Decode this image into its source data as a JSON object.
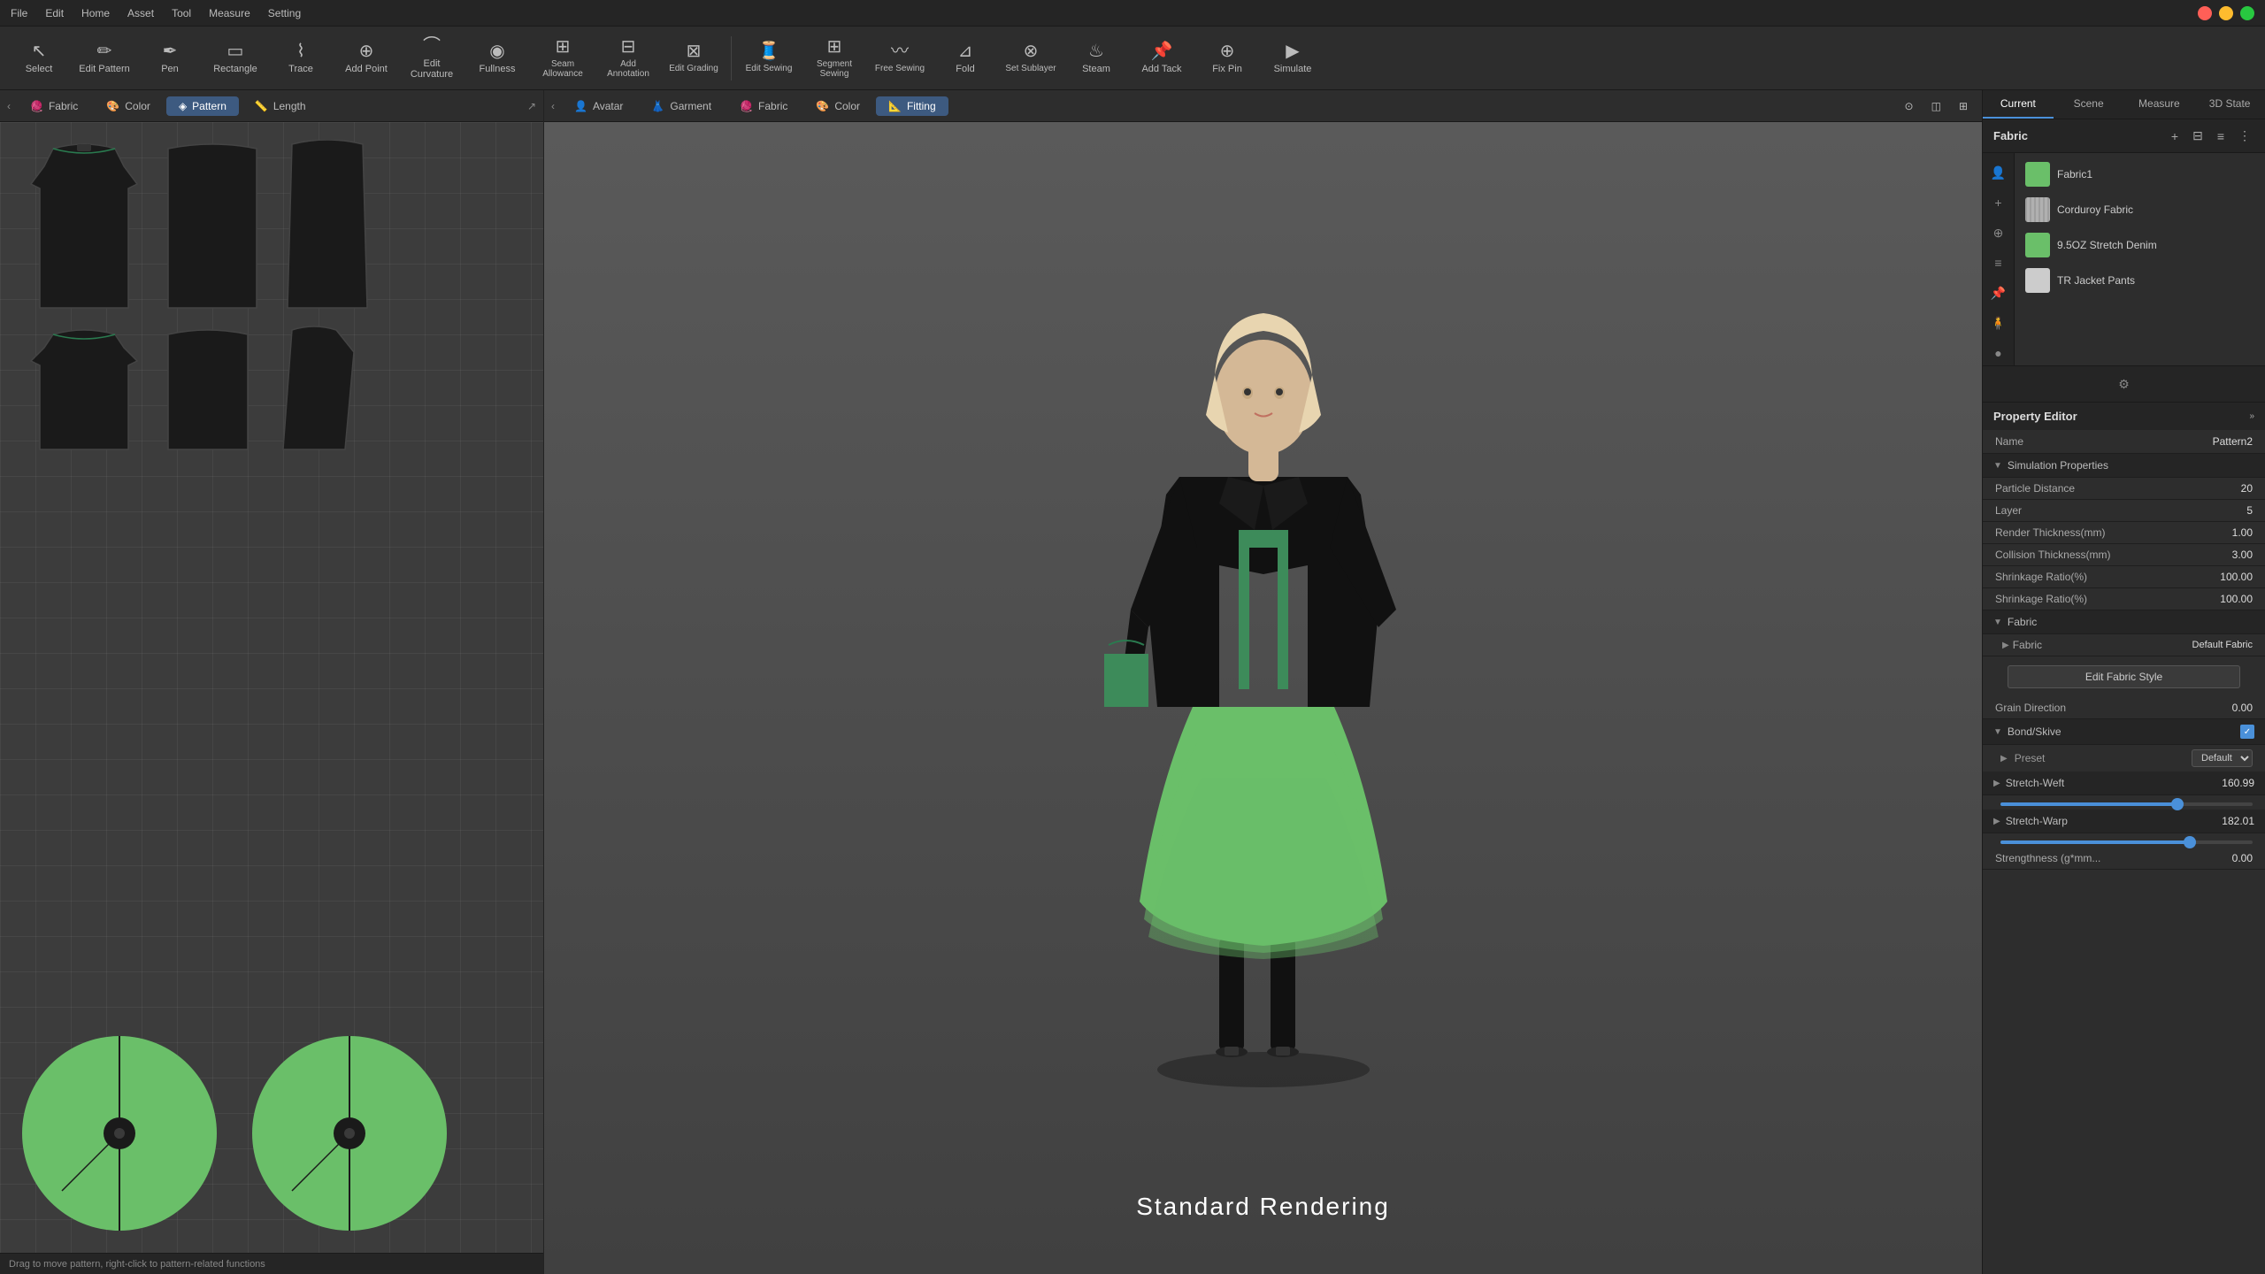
{
  "menubar": {
    "items": [
      "File",
      "Edit",
      "Home",
      "Asset",
      "Tool",
      "Measure",
      "Setting"
    ]
  },
  "toolbar": {
    "tools": [
      {
        "id": "select",
        "label": "Select",
        "icon": "↖",
        "active": false
      },
      {
        "id": "edit-pattern",
        "label": "Edit Pattern",
        "icon": "✏",
        "active": false
      },
      {
        "id": "pen",
        "label": "Pen",
        "icon": "✒",
        "active": false
      },
      {
        "id": "rectangle",
        "label": "Rectangle",
        "icon": "▭",
        "active": false
      },
      {
        "id": "trace",
        "label": "Trace",
        "icon": "⌇",
        "active": false
      },
      {
        "id": "add-point",
        "label": "Add Point",
        "icon": "⊕",
        "active": false
      },
      {
        "id": "edit-curvature",
        "label": "Edit Curvature",
        "icon": "⌒",
        "active": false
      },
      {
        "id": "fullness",
        "label": "Fullness",
        "icon": "◉",
        "active": false
      },
      {
        "id": "seam-allowance",
        "label": "Seam Allowance",
        "icon": "⊞",
        "active": false
      },
      {
        "id": "add-annotation",
        "label": "Add Annotation",
        "icon": "⊟",
        "active": false
      },
      {
        "id": "edit-grading",
        "label": "Edit Grading",
        "icon": "⊠",
        "active": false
      },
      {
        "id": "sep1",
        "sep": true
      },
      {
        "id": "edit-sewing",
        "label": "Edit Sewing",
        "icon": "🧵",
        "active": false
      },
      {
        "id": "segment-sewing",
        "label": "Segment Sewing",
        "icon": "⊞",
        "active": false
      },
      {
        "id": "free-sewing",
        "label": "Free Sewing",
        "icon": "〰",
        "active": false
      },
      {
        "id": "fold",
        "label": "Fold",
        "icon": "⊿",
        "active": false
      },
      {
        "id": "set-sublayer",
        "label": "Set Sublayer",
        "icon": "⊗",
        "active": false
      },
      {
        "id": "steam",
        "label": "Steam",
        "icon": "♨",
        "active": false
      },
      {
        "id": "add-tack",
        "label": "Add Tack",
        "icon": "📌",
        "active": false
      },
      {
        "id": "fix-pin",
        "label": "Fix Pin",
        "icon": "⊕",
        "active": false
      },
      {
        "id": "simulate",
        "label": "Simulate",
        "icon": "▶",
        "active": false
      }
    ]
  },
  "left_panel": {
    "tabs": [
      {
        "id": "fabric",
        "label": "Fabric",
        "active": false
      },
      {
        "id": "color",
        "label": "Color",
        "active": false
      },
      {
        "id": "pattern",
        "label": "Pattern",
        "active": true
      },
      {
        "id": "length",
        "label": "Length",
        "active": false
      }
    ]
  },
  "center_panel": {
    "tabs": [
      {
        "id": "avatar",
        "label": "Avatar",
        "active": false
      },
      {
        "id": "garment",
        "label": "Garment",
        "active": false
      },
      {
        "id": "fabric",
        "label": "Fabric",
        "active": false
      },
      {
        "id": "color",
        "label": "Color",
        "active": false
      },
      {
        "id": "fitting",
        "label": "Fitting",
        "active": true
      }
    ],
    "rendering_label": "Standard Rendering"
  },
  "right_panel": {
    "tabs": [
      {
        "id": "current",
        "label": "Current",
        "active": true
      },
      {
        "id": "scene",
        "label": "Scene",
        "active": false
      },
      {
        "id": "measure",
        "label": "Measure",
        "active": false
      },
      {
        "id": "3d-state",
        "label": "3D State",
        "active": false
      }
    ],
    "fabric_section": {
      "title": "Fabric",
      "items": [
        {
          "id": "fabric1",
          "name": "Fabric1",
          "color": "#6abf69"
        },
        {
          "id": "corduroy",
          "name": "Corduroy Fabric",
          "color": "#b0b0b0"
        },
        {
          "id": "stretch-denim",
          "name": "9.5OZ Stretch Denim",
          "color": "#6abf69"
        },
        {
          "id": "tr-jacket",
          "name": "TR Jacket Pants",
          "color": "#cccccc"
        }
      ]
    },
    "property_editor": {
      "title": "Property Editor",
      "name_label": "Name",
      "name_value": "Pattern2",
      "simulation_properties": {
        "title": "Simulation Properties",
        "properties": [
          {
            "label": "Particle Distance",
            "value": "20"
          },
          {
            "label": "Layer",
            "value": "5"
          },
          {
            "label": "Render Thickness(mm)",
            "value": "1.00"
          },
          {
            "label": "Collision Thickness(mm)",
            "value": "3.00"
          },
          {
            "label": "Shrinkage Ratio(%)",
            "value": "100.00"
          },
          {
            "label": "Shrinkage Ratio(%)",
            "value": "100.00"
          }
        ]
      },
      "fabric_section": {
        "title": "Fabric",
        "sub_title": "Fabric",
        "default_fabric": "Default Fabric",
        "edit_button": "Edit   Fabric Style",
        "grain_direction_label": "Grain Direction",
        "grain_direction_value": "0.00"
      },
      "bond_skive": {
        "title": "Bond/Skive",
        "preset_label": "Preset",
        "preset_value": "Default",
        "stretch_weft_label": "Stretch-Weft",
        "stretch_weft_value": "160.99",
        "stretch_weft_pct": 70,
        "stretch_warp_label": "Stretch-Warp",
        "stretch_warp_value": "182.01",
        "stretch_warp_pct": 75,
        "strengthness_label": "Strengthness (g*mm...",
        "strengthness_value": "0.00"
      }
    }
  },
  "status_bar": {
    "text": "Drag to move pattern, right-click to pattern-related functions"
  }
}
